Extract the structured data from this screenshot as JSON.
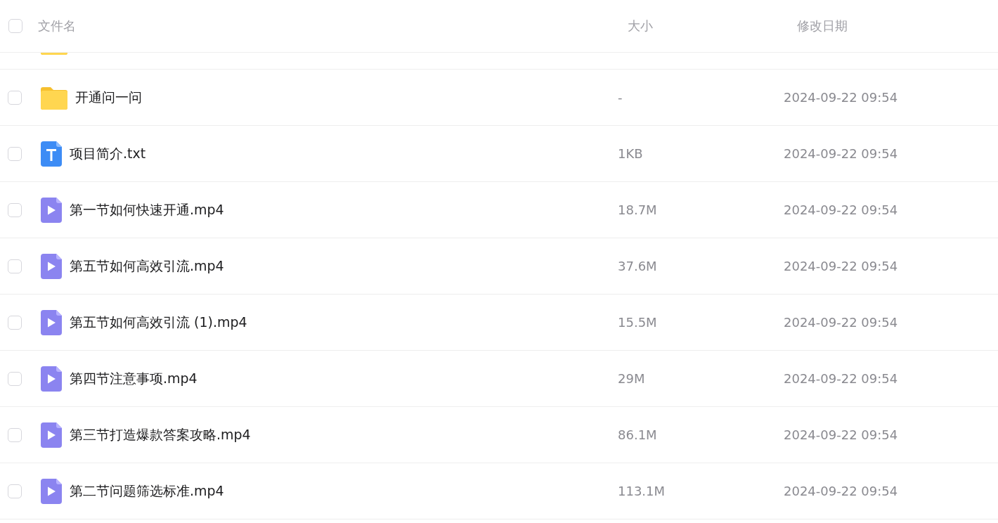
{
  "header": {
    "select_all": {
      "checked": false
    },
    "columns": [
      "文件名",
      "大小",
      "修改日期"
    ]
  },
  "partial_row": {
    "kind": "folder"
  },
  "rows": [
    {
      "kind": "folder",
      "name": "开通问一问",
      "size": "-",
      "modified": "2024-09-22 09:54",
      "checked": false
    },
    {
      "kind": "text",
      "name": "项目简介.txt",
      "size": "1KB",
      "modified": "2024-09-22 09:54",
      "checked": false
    },
    {
      "kind": "video",
      "name": "第一节如何快速开通.mp4",
      "size": "18.7M",
      "modified": "2024-09-22 09:54",
      "checked": false
    },
    {
      "kind": "video",
      "name": "第五节如何高效引流.mp4",
      "size": "37.6M",
      "modified": "2024-09-22 09:54",
      "checked": false
    },
    {
      "kind": "video",
      "name": "第五节如何高效引流 (1).mp4",
      "size": "15.5M",
      "modified": "2024-09-22 09:54",
      "checked": false
    },
    {
      "kind": "video",
      "name": "第四节注意事项.mp4",
      "size": "29M",
      "modified": "2024-09-22 09:54",
      "checked": false
    },
    {
      "kind": "video",
      "name": "第三节打造爆款答案攻略.mp4",
      "size": "86.1M",
      "modified": "2024-09-22 09:54",
      "checked": false
    },
    {
      "kind": "video",
      "name": "第二节问题筛选标准.mp4",
      "size": "113.1M",
      "modified": "2024-09-22 09:54",
      "checked": false
    }
  ]
}
